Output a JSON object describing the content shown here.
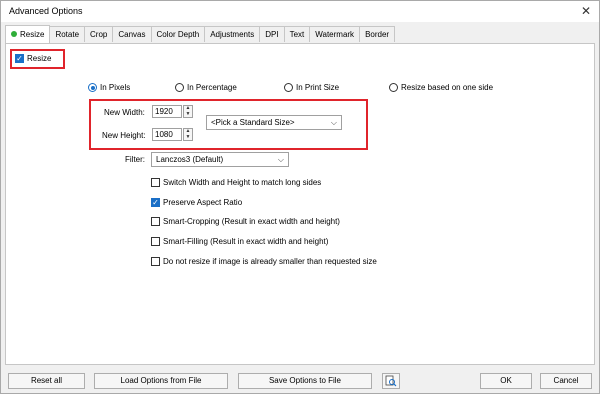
{
  "window": {
    "title": "Advanced Options",
    "close_glyph": "✕"
  },
  "tabs": [
    {
      "label": "Resize",
      "active": true
    },
    {
      "label": "Rotate"
    },
    {
      "label": "Crop"
    },
    {
      "label": "Canvas"
    },
    {
      "label": "Color Depth"
    },
    {
      "label": "Adjustments"
    },
    {
      "label": "DPI"
    },
    {
      "label": "Text"
    },
    {
      "label": "Watermark"
    },
    {
      "label": "Border"
    }
  ],
  "resize": {
    "enable_label": "Resize",
    "enable_checked": true,
    "modes": [
      {
        "label": "In Pixels",
        "selected": true
      },
      {
        "label": "In Percentage",
        "selected": false
      },
      {
        "label": "In Print Size",
        "selected": false
      },
      {
        "label": "Resize based on one side",
        "selected": false
      }
    ],
    "width_label": "New Width:",
    "width_value": "1920",
    "height_label": "New Height:",
    "height_value": "1080",
    "standard_size": "<Pick a Standard Size>",
    "filter_label": "Filter:",
    "filter_value": "Lanczos3 (Default)",
    "options": [
      {
        "label": "Switch Width and Height to match long sides",
        "checked": false
      },
      {
        "label": "Preserve Aspect Ratio",
        "checked": true
      },
      {
        "label": "Smart-Cropping (Result in exact width and height)",
        "checked": false
      },
      {
        "label": "Smart-Filling (Result in exact width and height)",
        "checked": false
      },
      {
        "label": "Do not resize if image is already smaller than requested size",
        "checked": false
      }
    ]
  },
  "footer": {
    "reset": "Reset all",
    "load": "Load Options from File",
    "save": "Save Options to File",
    "ok": "OK",
    "cancel": "Cancel"
  },
  "colors": {
    "highlight": "#e0242b",
    "accent": "#1a6fc7",
    "tab_dot": "#2fae39"
  },
  "icons": {
    "close": "close-icon",
    "preview": "magnifier-page-icon",
    "dropdown": "chevron-down-icon"
  }
}
